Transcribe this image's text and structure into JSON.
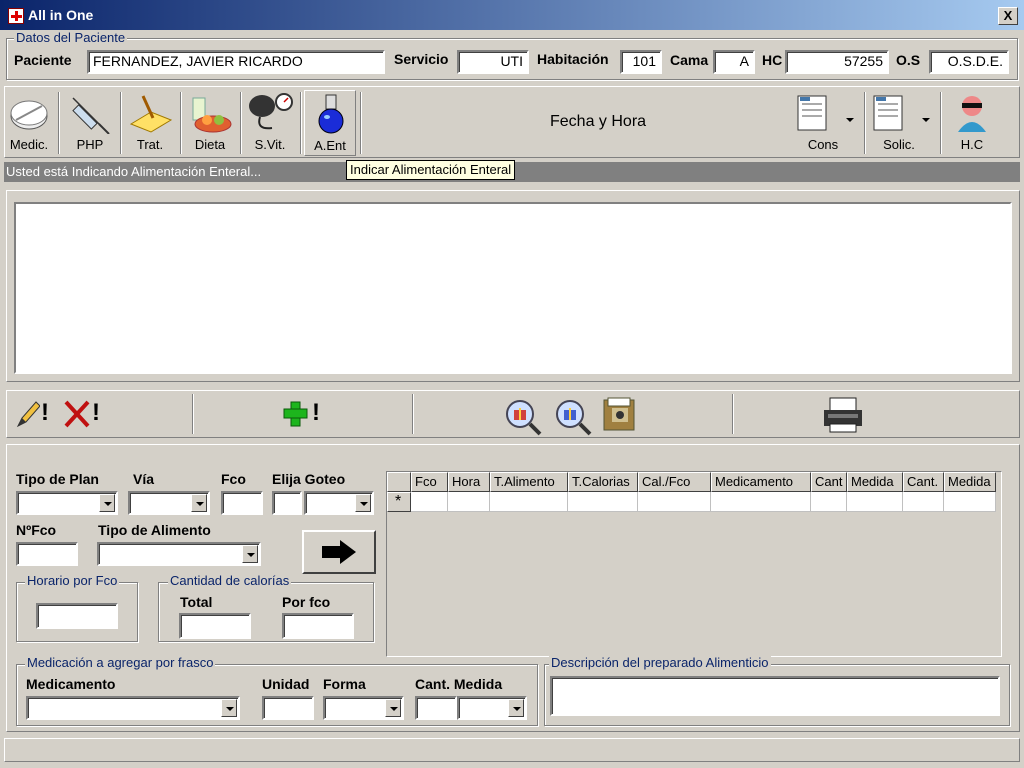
{
  "window": {
    "title": "All in One",
    "close": "X"
  },
  "patient": {
    "legend": "Datos del Paciente",
    "paciente_label": "Paciente",
    "paciente_value": "FERNANDEZ, JAVIER RICARDO",
    "servicio_label": "Servicio",
    "servicio_value": "UTI",
    "habitacion_label": "Habitación",
    "habitacion_value": "101",
    "cama_label": "Cama",
    "cama_value": "A",
    "hc_label": "HC",
    "hc_value": "57255",
    "os_label": "O.S",
    "os_value": "O.S.D.E."
  },
  "toolbar": {
    "items": [
      {
        "label": "Medic.",
        "icon": "pill-icon"
      },
      {
        "label": "PHP",
        "icon": "syringe-icon"
      },
      {
        "label": "Trat.",
        "icon": "notepad-icon"
      },
      {
        "label": "Dieta",
        "icon": "food-icon"
      },
      {
        "label": "S.Vit.",
        "icon": "blood-pressure-icon"
      },
      {
        "label": "A.Ent",
        "icon": "flask-icon"
      }
    ],
    "datetime_label": "Fecha y Hora",
    "cons_label": "Cons",
    "solic_label": "Solic.",
    "hc_label": "H.C"
  },
  "status": "Usted está Indicando Alimentación Enteral...",
  "tooltip": "Indicar Alimentación Enteral",
  "actions": {
    "edit_icon": "pencil-icon",
    "delete_icon": "x-icon",
    "add_icon": "plus-icon",
    "search_icons": [
      "search-gift-icon",
      "search-icon",
      "folder-icon"
    ],
    "print_icon": "printer-icon",
    "exclaim": "!"
  },
  "form": {
    "tipo_plan": "Tipo de Plan",
    "via": "Vía",
    "fco": "Fco",
    "elija_goteo": "Elija Goteo",
    "nfco": "NºFco",
    "tipo_alimento": "Tipo de Alimento",
    "horario_legend": "Horario por Fco",
    "calorias_legend": "Cantidad de calorías",
    "total": "Total",
    "por_fco": "Por fco"
  },
  "grid": {
    "columns": [
      "Fco",
      "Hora",
      "T.Alimento",
      "T.Calorias",
      "Cal./Fco",
      "Medicamento",
      "Cant",
      "Medida",
      "Cant.",
      "Medida"
    ],
    "new_row_marker": "*"
  },
  "medication": {
    "legend": "Medicación a agregar por frasco",
    "medicamento": "Medicamento",
    "unidad": "Unidad",
    "forma": "Forma",
    "cant_medida": "Cant. Medida"
  },
  "description": {
    "legend": "Descripción del preparado Alimenticio"
  }
}
